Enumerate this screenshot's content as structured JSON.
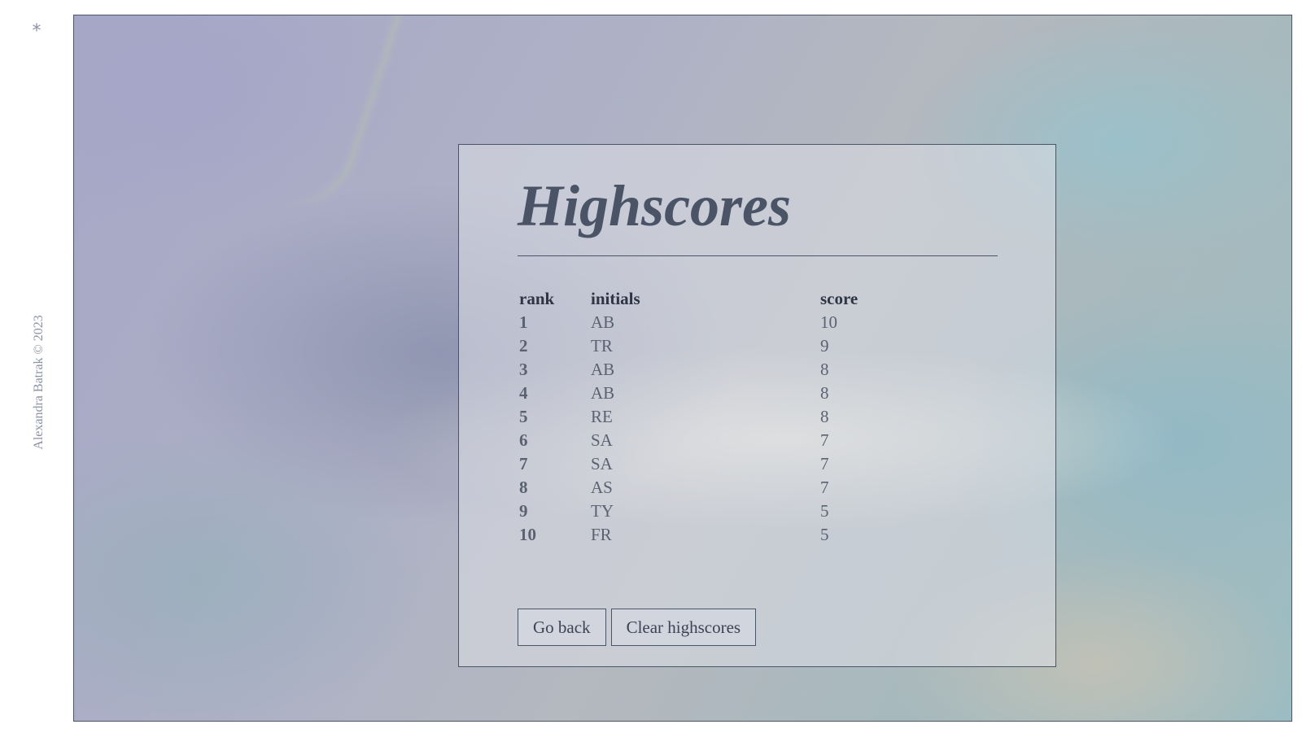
{
  "sidebar": {
    "mark": "*",
    "credit": "Alexandra Batrak © 2023"
  },
  "panel": {
    "title": "Highscores",
    "table": {
      "headers": {
        "rank": "rank",
        "initials": "initials",
        "score": "score"
      },
      "rows": [
        {
          "rank": "1",
          "initials": "AB",
          "score": "10"
        },
        {
          "rank": "2",
          "initials": "TR",
          "score": "9"
        },
        {
          "rank": "3",
          "initials": "AB",
          "score": "8"
        },
        {
          "rank": "4",
          "initials": "AB",
          "score": "8"
        },
        {
          "rank": "5",
          "initials": "RE",
          "score": "8"
        },
        {
          "rank": "6",
          "initials": "SA",
          "score": "7"
        },
        {
          "rank": "7",
          "initials": "SA",
          "score": "7"
        },
        {
          "rank": "8",
          "initials": "AS",
          "score": "7"
        },
        {
          "rank": "9",
          "initials": "TY",
          "score": "5"
        },
        {
          "rank": "10",
          "initials": "FR",
          "score": "5"
        }
      ]
    },
    "buttons": {
      "go_back": "Go back",
      "clear": "Clear highscores"
    }
  }
}
